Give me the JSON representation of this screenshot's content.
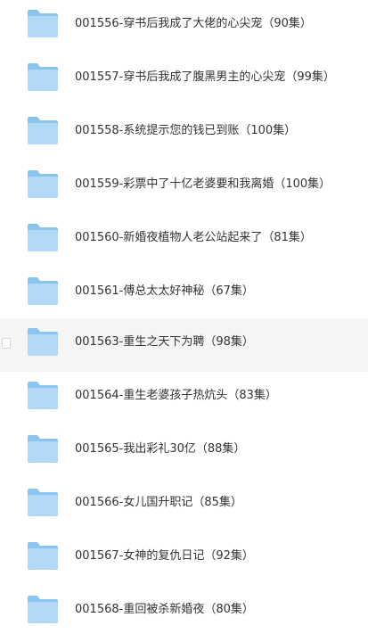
{
  "colors": {
    "folder_back": "#8cc4f0",
    "folder_front": "#b2daf8",
    "text": "#333333",
    "hover_bg": "#f5f5f6"
  },
  "files": [
    {
      "icon": "folder-icon",
      "name": "001556-穿书后我成了大佬的心尖宠（90集）",
      "hovered": false
    },
    {
      "icon": "folder-icon",
      "name": "001557-穿书后我成了腹黑男主的心尖宠（99集）",
      "hovered": false
    },
    {
      "icon": "folder-icon",
      "name": "001558-系统提示您的钱已到账（100集）",
      "hovered": false
    },
    {
      "icon": "folder-icon",
      "name": "001559-彩票中了十亿老婆要和我离婚（100集）",
      "hovered": false
    },
    {
      "icon": "folder-icon",
      "name": "001560-新婚夜植物人老公站起来了（81集）",
      "hovered": false
    },
    {
      "icon": "folder-icon",
      "name": "001561-傅总太太好神秘（67集）",
      "hovered": false
    },
    {
      "icon": "folder-icon",
      "name": "001563-重生之天下为聘（98集）",
      "hovered": true
    },
    {
      "icon": "folder-icon",
      "name": "001564-重生老婆孩子热炕头（83集）",
      "hovered": false
    },
    {
      "icon": "folder-icon",
      "name": "001565-我出彩礼30亿（88集）",
      "hovered": false
    },
    {
      "icon": "folder-icon",
      "name": "001566-女儿国升职记（85集）",
      "hovered": false
    },
    {
      "icon": "folder-icon",
      "name": "001567-女神的复仇日记（92集）",
      "hovered": false
    },
    {
      "icon": "folder-icon",
      "name": "001568-重回被杀新婚夜（80集）",
      "hovered": false
    }
  ]
}
